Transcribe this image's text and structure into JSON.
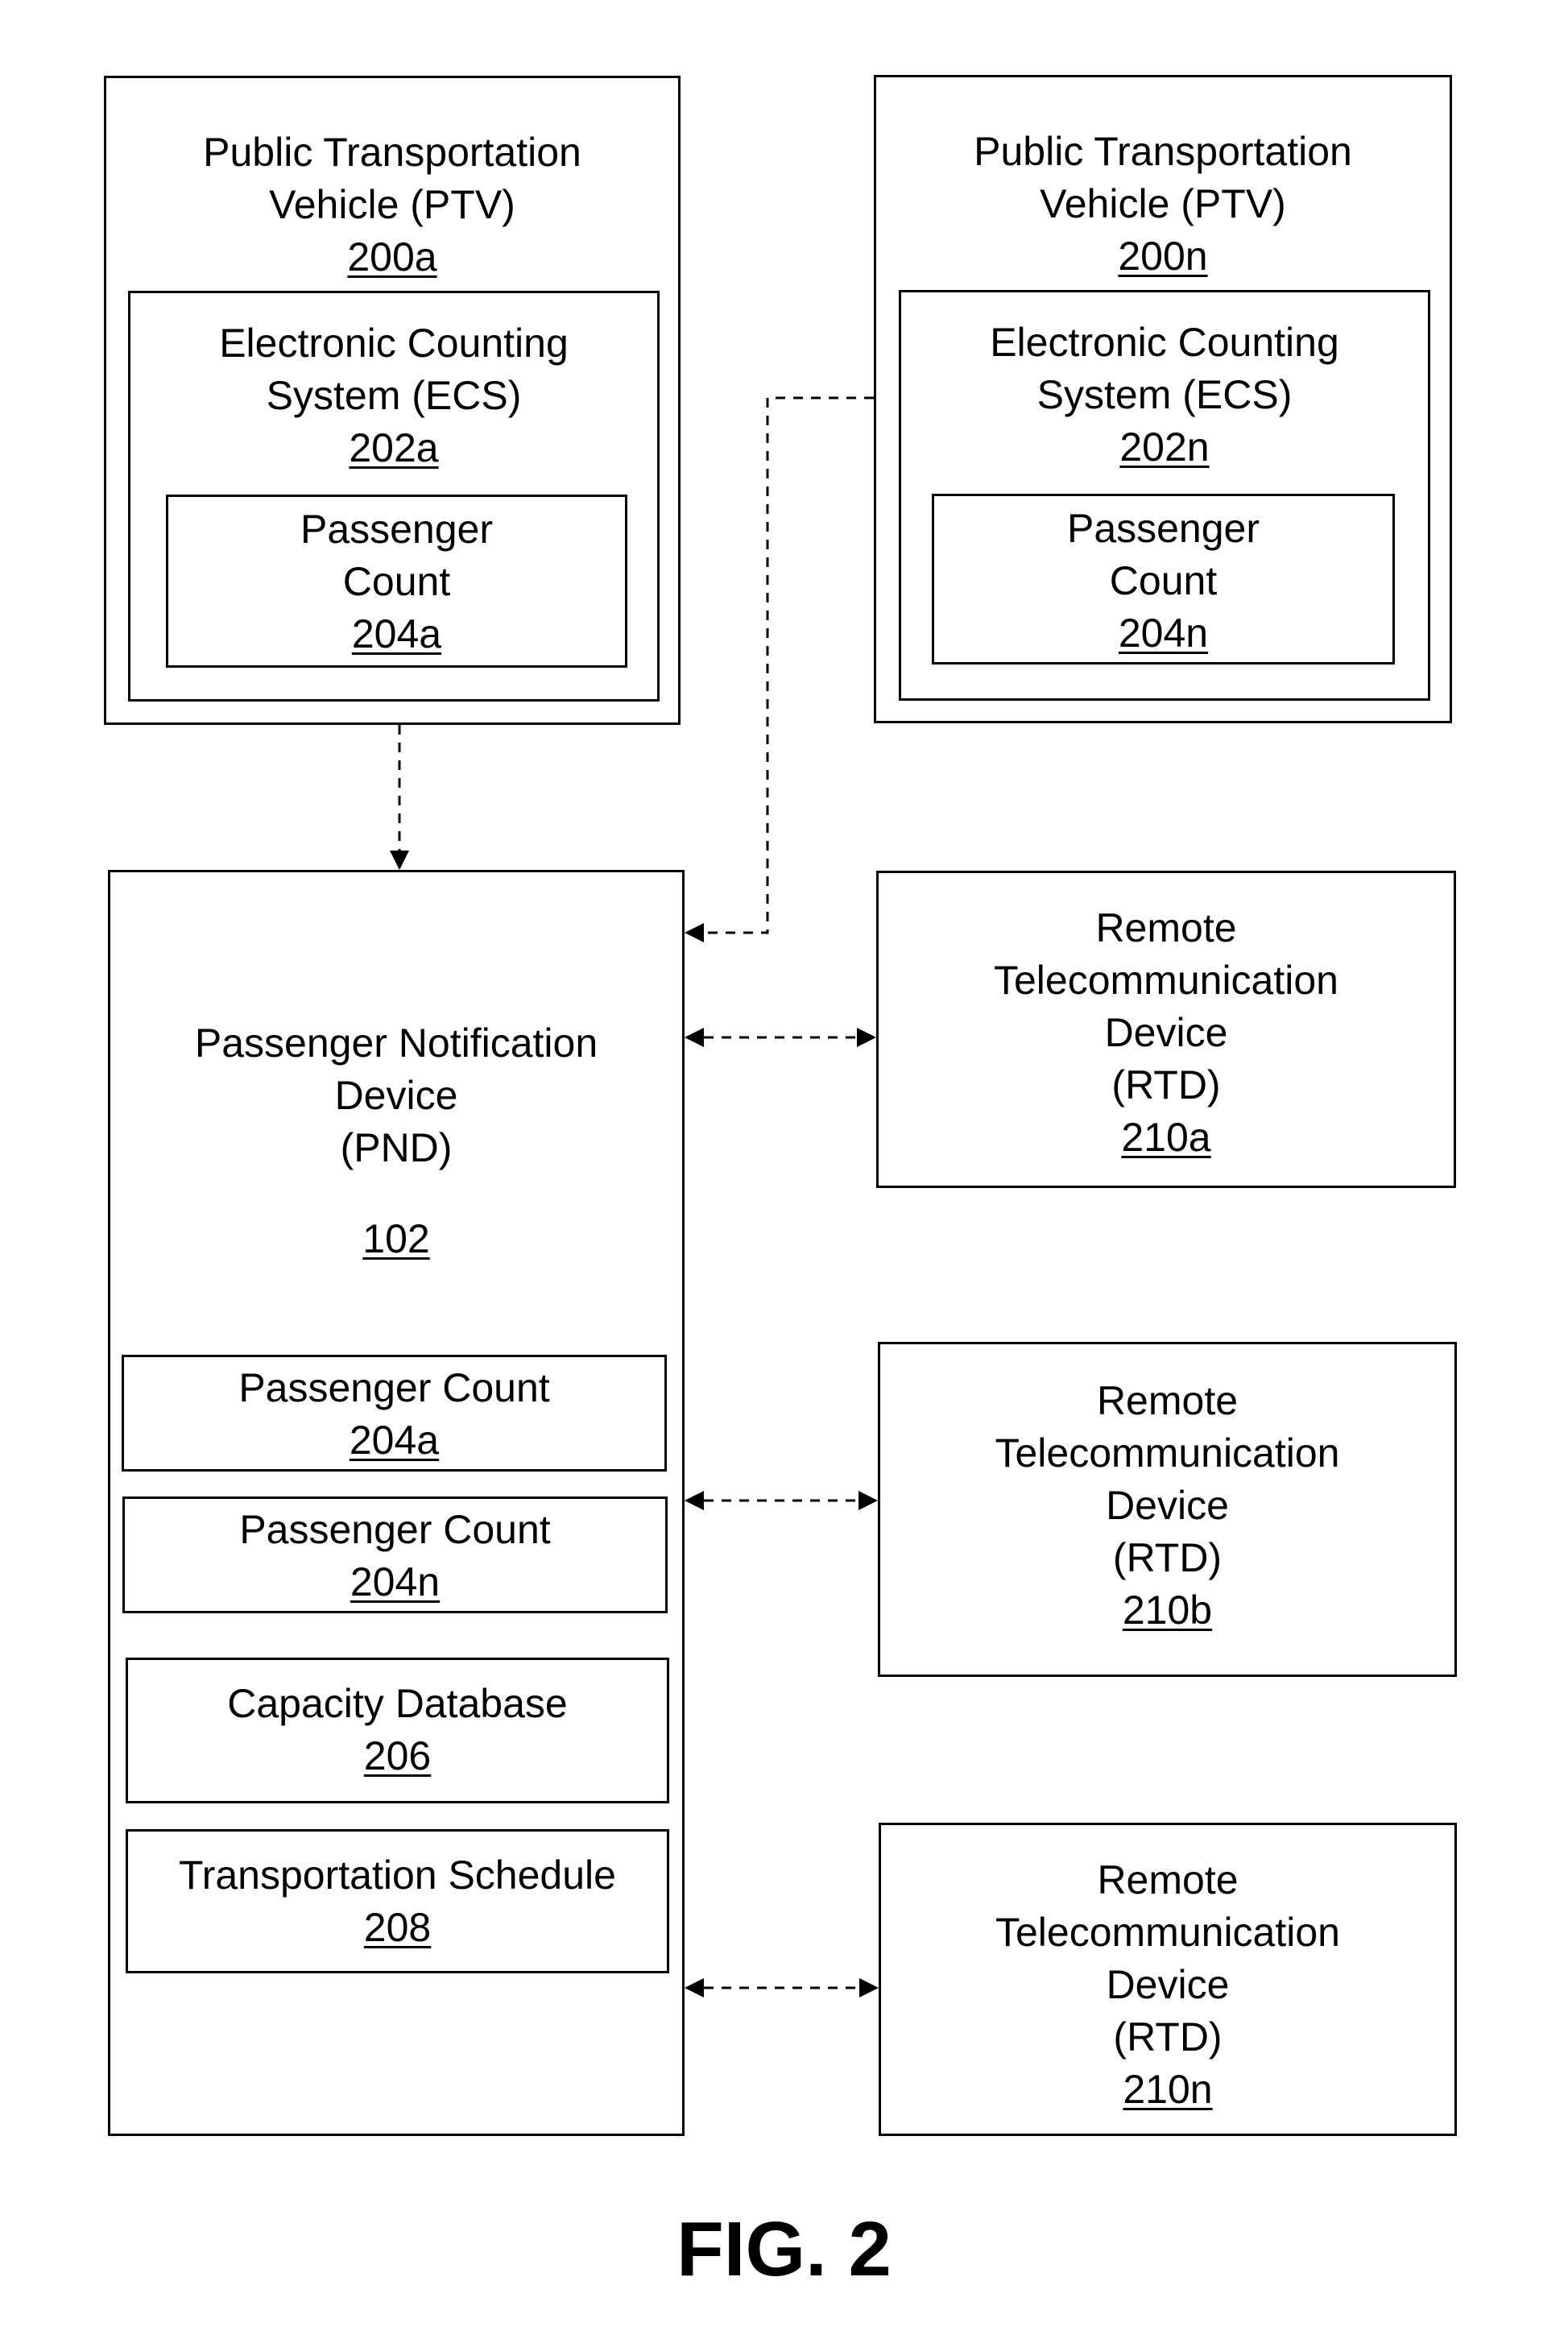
{
  "figure_label": "FIG. 2",
  "ptv_a": {
    "title_lines": [
      "Public Transportation",
      "Vehicle (PTV)"
    ],
    "ref": "200a",
    "ecs": {
      "title_lines": [
        "Electronic Counting",
        "System (ECS)"
      ],
      "ref": "202a",
      "count": {
        "title_lines": [
          "Passenger",
          "Count"
        ],
        "ref": "204a"
      }
    }
  },
  "ptv_n": {
    "title_lines": [
      "Public Transportation",
      "Vehicle (PTV)"
    ],
    "ref": "200n",
    "ecs": {
      "title_lines": [
        "Electronic Counting",
        "System (ECS)"
      ],
      "ref": "202n",
      "count": {
        "title_lines": [
          "Passenger",
          "Count"
        ],
        "ref": "204n"
      }
    }
  },
  "pnd": {
    "title_lines": [
      "Passenger Notification",
      "Device",
      "(PND)"
    ],
    "ref": "102",
    "components": [
      {
        "title": "Passenger Count",
        "ref": "204a"
      },
      {
        "title": "Passenger Count",
        "ref": "204n"
      },
      {
        "title": "Capacity Database",
        "ref": "206"
      },
      {
        "title": "Transportation Schedule",
        "ref": "208"
      }
    ]
  },
  "rtds": [
    {
      "title_lines": [
        "Remote",
        "Telecommunication",
        "Device",
        "(RTD)"
      ],
      "ref": "210a"
    },
    {
      "title_lines": [
        "Remote",
        "Telecommunication",
        "Device",
        "(RTD)"
      ],
      "ref": "210b"
    },
    {
      "title_lines": [
        "Remote",
        "Telecommunication",
        "Device",
        "(RTD)"
      ],
      "ref": "210n"
    }
  ],
  "connections": [
    {
      "from": "200a",
      "to": "102",
      "style": "dashed",
      "direction": "one-way"
    },
    {
      "from": "200n",
      "to": "102",
      "style": "dashed",
      "direction": "one-way"
    },
    {
      "from": "102",
      "to": "210a",
      "style": "dashed",
      "direction": "two-way"
    },
    {
      "from": "102",
      "to": "210b",
      "style": "dashed",
      "direction": "two-way"
    },
    {
      "from": "102",
      "to": "210n",
      "style": "dashed",
      "direction": "two-way"
    }
  ]
}
